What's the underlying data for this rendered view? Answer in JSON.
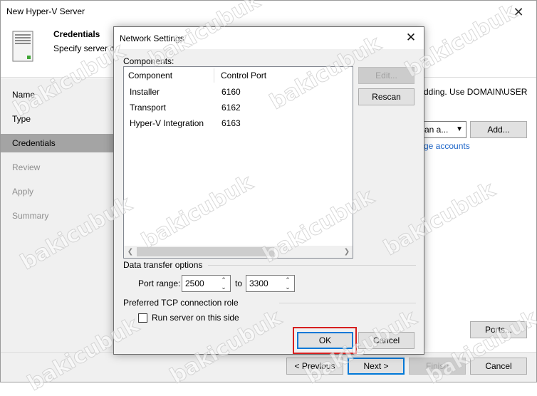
{
  "window": {
    "title": "New Hyper-V Server",
    "close_glyph": "✕"
  },
  "header": {
    "title": "Credentials",
    "subtitle": "Specify server cr"
  },
  "nav": {
    "items": [
      {
        "label": "Name",
        "state": "normal"
      },
      {
        "label": "Type",
        "state": "normal"
      },
      {
        "label": "Credentials",
        "state": "active"
      },
      {
        "label": "Review",
        "state": "disabled"
      },
      {
        "label": "Apply",
        "state": "disabled"
      },
      {
        "label": "Summary",
        "state": "disabled"
      }
    ]
  },
  "content": {
    "hint_text": "dding. Use DOMAIN\\USER",
    "account_select_value": "an a...",
    "add_button": "Add...",
    "manage_link": "ge accounts",
    "ports_button": "Ports..."
  },
  "footer": {
    "previous": "< Previous",
    "next": "Next >",
    "finish": "Finish",
    "cancel": "Cancel"
  },
  "dialog": {
    "title": "Network Settings",
    "close_glyph": "✕",
    "components_label": "Components:",
    "columns": [
      "Component",
      "Control Port"
    ],
    "rows": [
      {
        "component": "Installer",
        "port": "6160"
      },
      {
        "component": "Transport",
        "port": "6162"
      },
      {
        "component": "Hyper-V Integration",
        "port": "6163"
      }
    ],
    "edit_button": "Edit...",
    "rescan_button": "Rescan",
    "data_transfer_label": "Data transfer options",
    "port_range_label": "Port range:",
    "port_from": "2500",
    "to_label": "to",
    "port_to": "3300",
    "tcp_role_label": "Preferred TCP connection role",
    "run_server_label": "Run server on this side",
    "run_server_checked": false,
    "ok_button": "OK",
    "cancel_button": "Cancel"
  },
  "watermark": "bakicubuk",
  "colors": {
    "accent": "#0078d7",
    "highlight_box": "#d61f1f",
    "link": "#1b64c8",
    "nav_active": "#a4a4a4"
  }
}
